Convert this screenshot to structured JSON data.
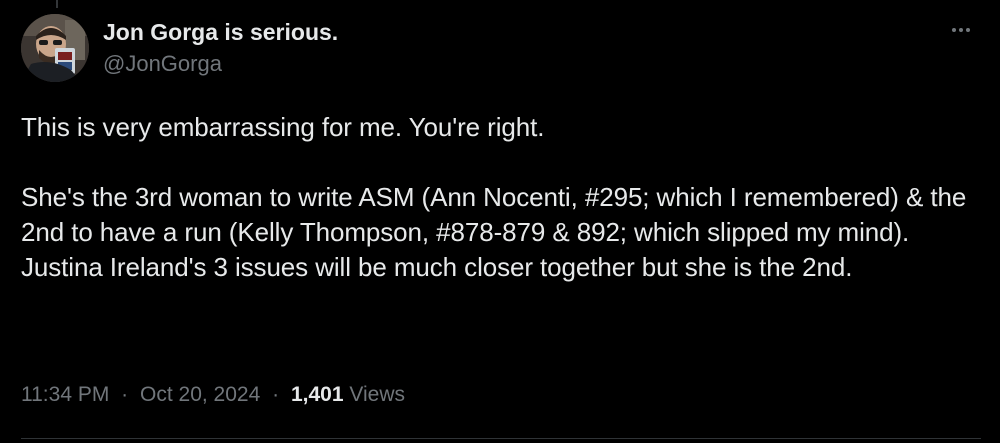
{
  "author": {
    "display_name": "Jon Gorga is serious.",
    "handle": "@JonGorga"
  },
  "icons": {
    "more": "more-horizontal-icon"
  },
  "tweet": {
    "paragraph_1": "This is very embarrassing for me. You're right.",
    "paragraph_2": "She's the 3rd woman to write ASM (Ann Nocenti, #295; which I remembered) & the 2nd to have a run (Kelly Thompson, #878-879 & 892; which slipped my mind). Justina Ireland's 3 issues will be much closer together but she is the 2nd."
  },
  "meta": {
    "time": "11:34 PM",
    "separator": "·",
    "date": "Oct 20, 2024",
    "views_count": "1,401",
    "views_label": "Views"
  },
  "colors": {
    "background": "#000000",
    "text_primary": "#e7e9ea",
    "text_secondary": "#71767b",
    "border": "#2f3336"
  }
}
